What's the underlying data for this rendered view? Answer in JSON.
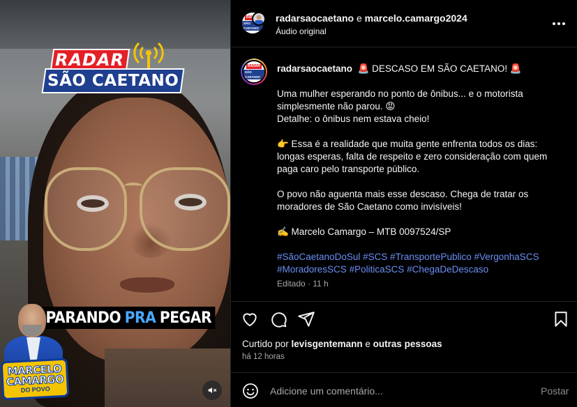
{
  "video": {
    "logo_line1": "RADAR",
    "logo_line2": "SÃO CAETANO",
    "caption_pre": "PARANDO",
    "caption_hl": "PRA",
    "caption_post": "PEGAR",
    "badge_line1": "MARCELO",
    "badge_line2": "CAMARGO",
    "badge_line3": "DO POVO",
    "mute_icon": "speaker-muted-icon"
  },
  "header": {
    "user1": "radarsaocaetano",
    "conj": " e ",
    "user2": "marcelo.camargo2024",
    "audio": "Áudio original",
    "more_icon": "more-horizontal-icon"
  },
  "caption": {
    "username": "radarsaocaetano",
    "line1": "🚨 DESCASO EM SÃO CAETANO! 🚨",
    "p1a": "Uma mulher esperando no ponto de ônibus... e o motorista simplesmente não parou. 😡",
    "p1b": "Detalhe: o ônibus nem estava cheio!",
    "p2": "👉 Essa é a realidade que muita gente enfrenta todos os dias: longas esperas, falta de respeito e zero consideração com quem paga caro pelo transporte público.",
    "p3": "O povo não aguenta mais esse descaso. Chega de tratar os moradores de São Caetano como invisíveis!",
    "p4": "✍️ Marcelo Camargo – MTB 0097524/SP",
    "hashtags": [
      "#SãoCaetanoDoSul",
      "#SCS",
      "#TransportePublico",
      "#VergonhaSCS",
      "#MoradoresSCS",
      "#PoliticaSCS",
      "#ChegaDeDescaso"
    ],
    "edited": "Editado · 11 h"
  },
  "actions": {
    "like_icon": "heart-icon",
    "comment_icon": "comment-icon",
    "share_icon": "send-icon",
    "save_icon": "bookmark-icon"
  },
  "likes": {
    "prefix": "Curtido por ",
    "user": "levisgentemann",
    "mid": " e ",
    "others": "outras pessoas"
  },
  "time": "há 12 horas",
  "comment": {
    "placeholder": "Adicione um comentário...",
    "post": "Postar",
    "emoji_icon": "emoji-icon"
  },
  "colors": {
    "background": "#000000",
    "hashtag": "#6c8ff5",
    "logo_red": "#e22026",
    "logo_blue": "#1f3f8f"
  }
}
